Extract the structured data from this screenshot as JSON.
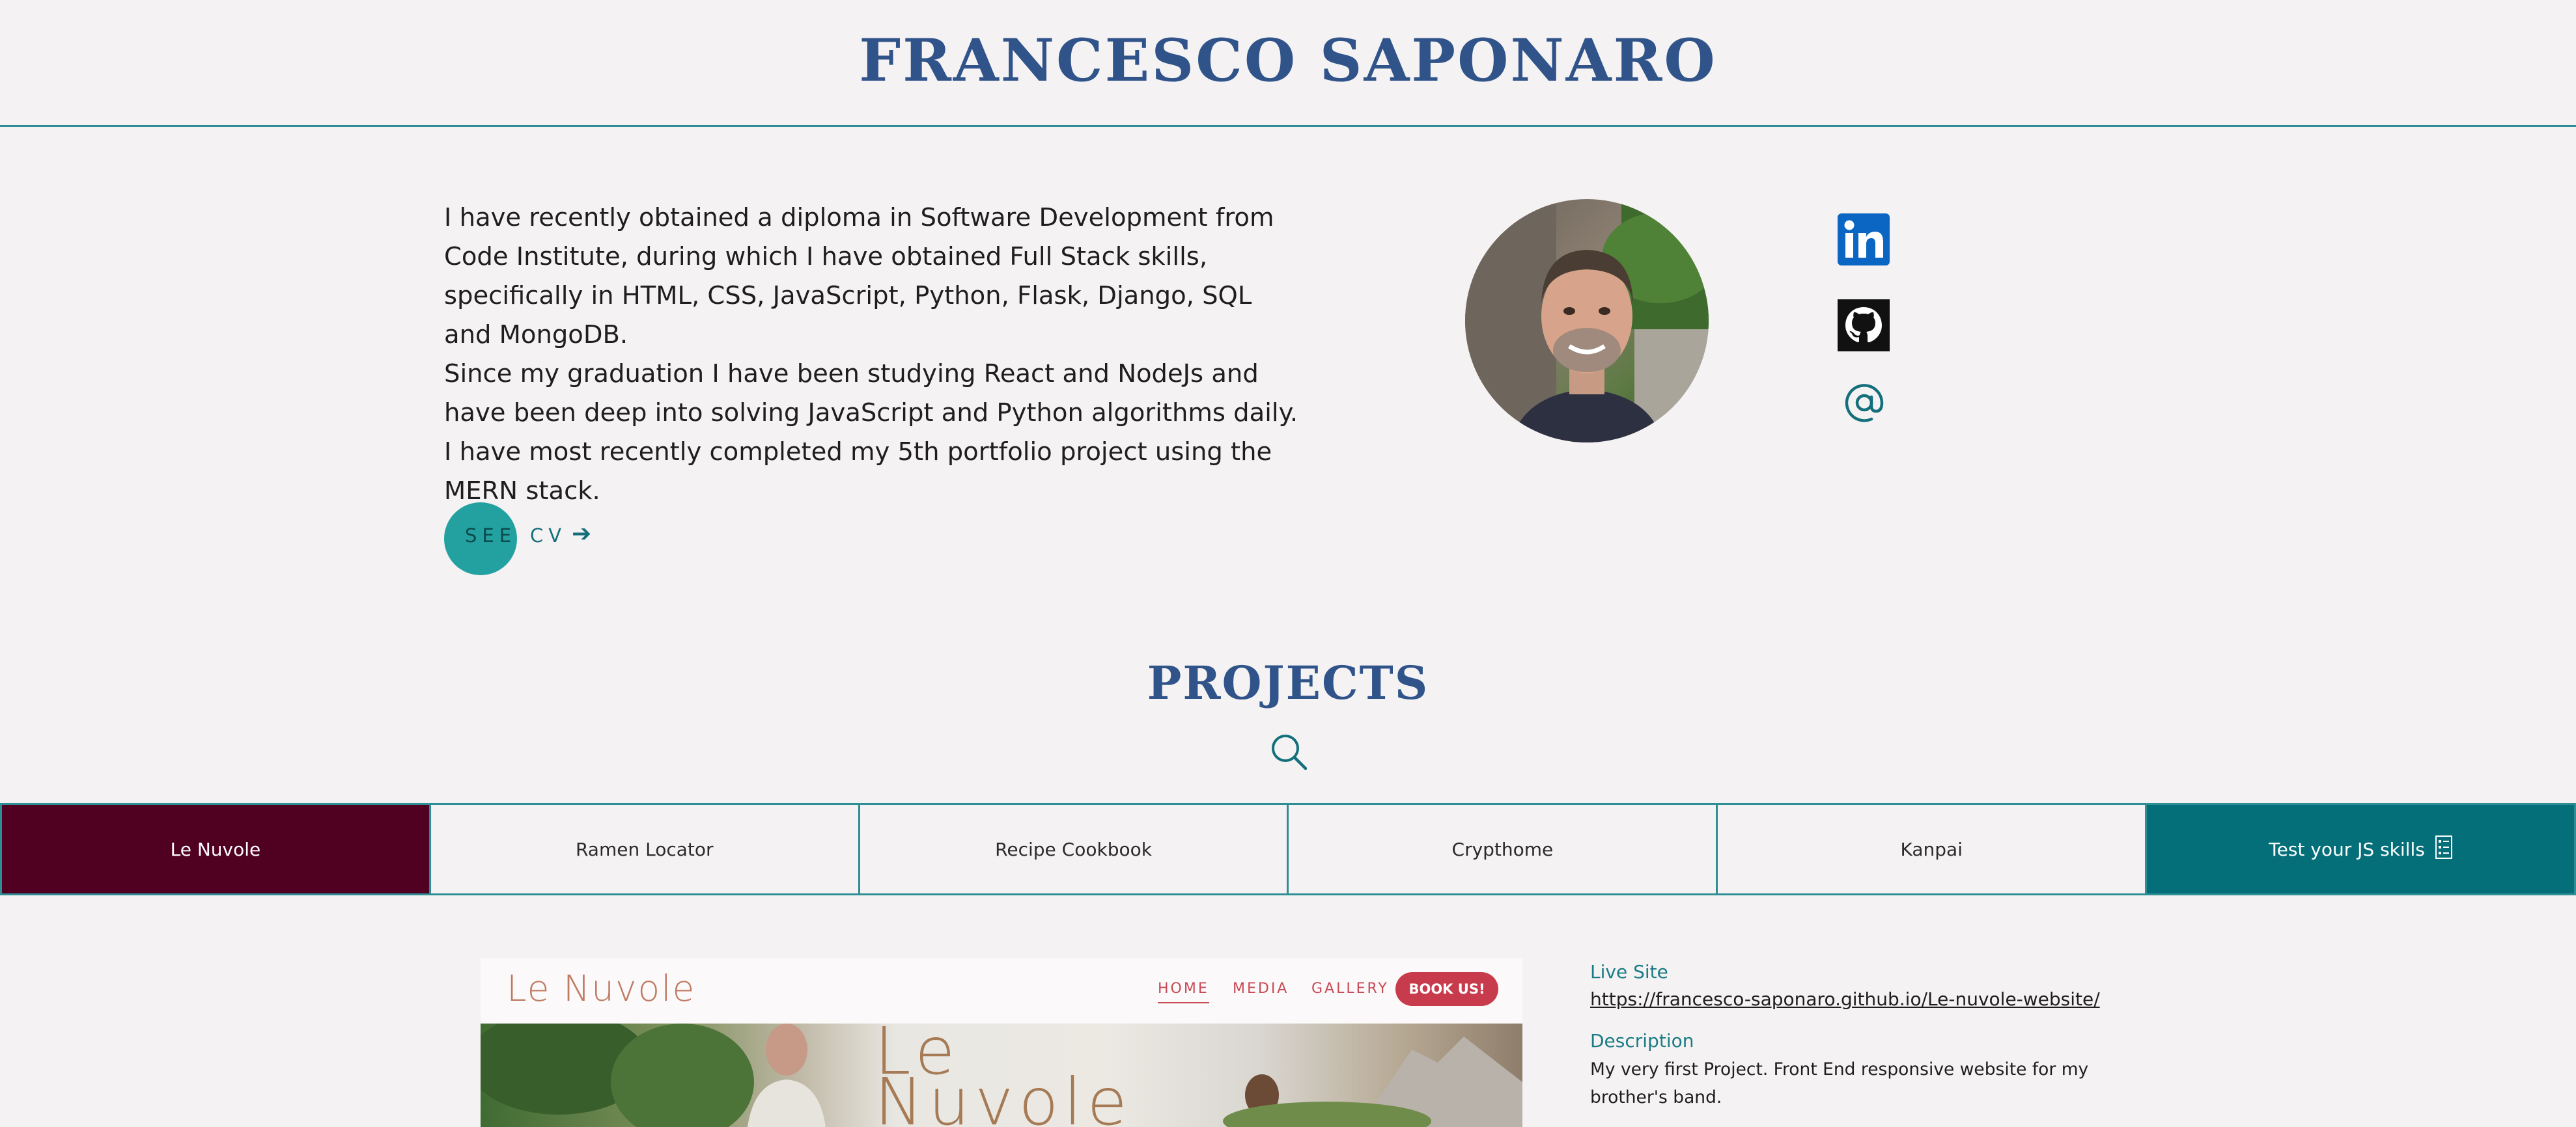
{
  "header": {
    "title": "FRANCESCO SAPONARO"
  },
  "about": {
    "paragraphs": [
      "I have recently obtained a diploma in Software Development from Code Institute, during which I have obtained Full Stack skills, specifically in HTML, CSS, JavaScript, Python, Flask, Django, SQL and MongoDB.",
      "Since my graduation I have been studying React and NodeJs and have been deep into solving JavaScript and Python algorithms daily.",
      "I have most recently completed my 5th portfolio project using the MERN stack."
    ],
    "cv_button": {
      "see": "SEE",
      "cv": "CV",
      "arrow": "➔"
    }
  },
  "social": [
    {
      "name": "linkedin-icon",
      "color": "#0a66c2"
    },
    {
      "name": "github-icon",
      "color": "#111111"
    },
    {
      "name": "email-icon",
      "color": "#136f7b"
    }
  ],
  "projects": {
    "title": "PROJECTS",
    "tabs": [
      {
        "label": "Le Nuvole",
        "state": "active"
      },
      {
        "label": "Ramen Locator",
        "state": ""
      },
      {
        "label": "Recipe Cookbook",
        "state": ""
      },
      {
        "label": "Crypthome",
        "state": ""
      },
      {
        "label": "Kanpai",
        "state": ""
      },
      {
        "label": "Test your JS skills",
        "state": "accent",
        "icon": "list-icon"
      }
    ]
  },
  "preview": {
    "brand": "Le Nuvole",
    "nav": [
      "HOME",
      "MEDIA",
      "GALLERY"
    ],
    "cta": "BOOK US!",
    "hero_line1": "Le",
    "hero_line2": "Nuvole"
  },
  "project_info": {
    "live_label": "Live Site",
    "live_url": "https://francesco-saponaro.github.io/Le-nuvole-website/",
    "desc_label": "Description",
    "desc_text": "My very first Project. Front End responsive website for my brother's band."
  },
  "colors": {
    "title": "#30548a",
    "accent_teal": "#046f78",
    "active_tab": "#500021",
    "cv_circle": "#22a1a0",
    "divider": "#2d8e95"
  }
}
